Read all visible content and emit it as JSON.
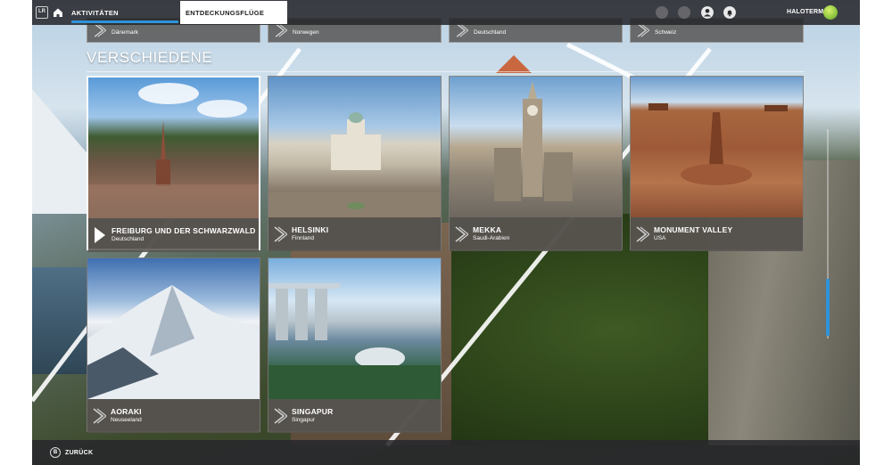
{
  "header": {
    "profile_icon_text": "LR",
    "tabs": [
      {
        "label": "AKTIVITÄTEN",
        "active": true
      },
      {
        "label": "ENTDECKUNGSFLÜGE",
        "active": false
      }
    ],
    "username": "HALOTERM",
    "accent_color": "#2e93d9"
  },
  "top_row_partial": [
    {
      "subtitle": "Dänemark"
    },
    {
      "subtitle": "Norwegen"
    },
    {
      "subtitle": "Deutschland"
    },
    {
      "subtitle": "Schweiz"
    }
  ],
  "section": {
    "title": "VERSCHIEDENE"
  },
  "tiles": [
    {
      "name": "FREIBURG UND DER SCHWARZWALD",
      "country": "Deutschland",
      "selected": true
    },
    {
      "name": "HELSINKI",
      "country": "Finnland",
      "selected": false
    },
    {
      "name": "MEKKA",
      "country": "Saudi-Arabien",
      "selected": false
    },
    {
      "name": "MONUMENT VALLEY",
      "country": "USA",
      "selected": false
    },
    {
      "name": "AORAKI",
      "country": "Neuseeland",
      "selected": false
    },
    {
      "name": "SINGAPUR",
      "country": "Singapur",
      "selected": false
    }
  ],
  "footer": {
    "back_key": "B",
    "back_label": "ZURÜCK"
  }
}
